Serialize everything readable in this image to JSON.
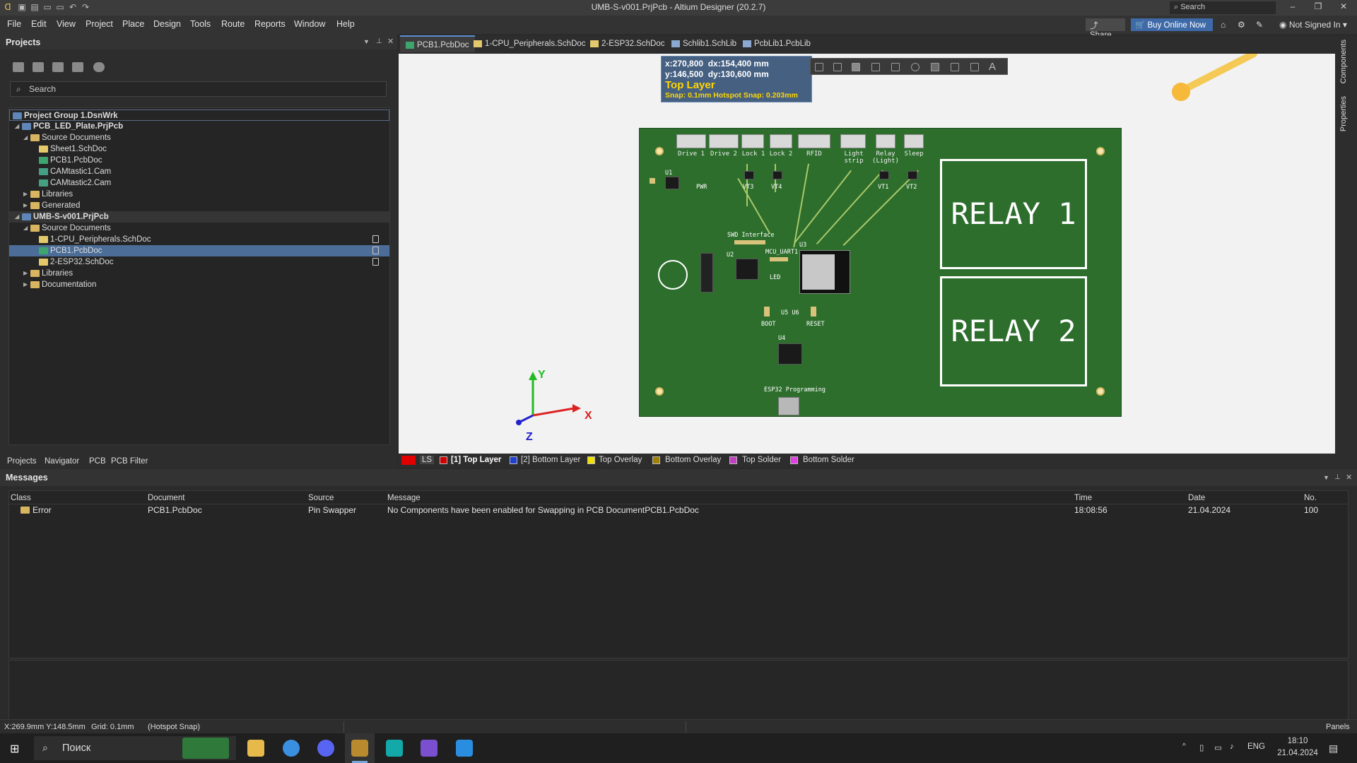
{
  "window": {
    "title": "UMB-S-v001.PrjPcb - Altium Designer (20.2.7)",
    "search_placeholder": "Search",
    "min": "–",
    "max": "❐",
    "close": "✕"
  },
  "menu": [
    "File",
    "Edit",
    "View",
    "Project",
    "Place",
    "Design",
    "Tools",
    "Route",
    "Reports",
    "Window",
    "Help"
  ],
  "topright": {
    "share": "Share",
    "buy": "Buy Online Now",
    "signin": "Not Signed In"
  },
  "projects_panel": {
    "title": "Projects",
    "search_placeholder": "Search",
    "tree": [
      {
        "label": "Project Group 1.DsnWrk"
      },
      {
        "label": "PCB_LED_Plate.PrjPcb"
      },
      {
        "label": "Source Documents"
      },
      {
        "label": "Sheet1.SchDoc"
      },
      {
        "label": "PCB1.PcbDoc"
      },
      {
        "label": "CAMtastic1.Cam"
      },
      {
        "label": "CAMtastic2.Cam"
      },
      {
        "label": "Libraries"
      },
      {
        "label": "Generated"
      },
      {
        "label": "UMB-S-v001.PrjPcb"
      },
      {
        "label": "Source Documents"
      },
      {
        "label": "1-CPU_Peripherals.SchDoc"
      },
      {
        "label": "PCB1.PcbDoc"
      },
      {
        "label": "2-ESP32.SchDoc"
      },
      {
        "label": "Libraries"
      },
      {
        "label": "Documentation"
      }
    ],
    "tabs": [
      "Projects",
      "Navigator",
      "PCB",
      "PCB Filter"
    ]
  },
  "doc_tabs": [
    "PCB1.PcbDoc",
    "1-CPU_Peripherals.SchDoc",
    "2-ESP32.SchDoc",
    "Schlib1.SchLib",
    "PcbLib1.PcbLib"
  ],
  "right_tabs": [
    "Components",
    "Properties"
  ],
  "hud": {
    "x": "x:270,800",
    "dx": "dx:154,400 mm",
    "y": "y:146,500",
    "dy": "dy:130,600 mm",
    "layer": "Top Layer",
    "snap": "Snap: 0.1mm Hotspot Snap: 0.203mm"
  },
  "board": {
    "connectors": [
      "Drive 1",
      "Drive 2",
      "Lock 1",
      "Lock 2",
      "RFID",
      "Light strip",
      "Relay (Light)",
      "Sleep"
    ],
    "relays": [
      "RELAY 1",
      "RELAY 2"
    ],
    "labels": {
      "u1": "U1",
      "pwr": "PWR",
      "swd": "SWD Interface",
      "mcu_uart": "MCU_UART1",
      "u2": "U2",
      "u3": "U3",
      "u4": "U4",
      "u5u6": "U5 U6",
      "led": "LED",
      "boot": "BOOT",
      "reset": "RESET",
      "esp_prog": "ESP32 Programming",
      "vt3": "VT3",
      "vt4": "VT4",
      "vt1": "VT1",
      "vt2": "VT2"
    }
  },
  "axes": {
    "x": "X",
    "y": "Y",
    "z": "Z"
  },
  "layer_bar": [
    {
      "label": "LS",
      "color": "#e00000"
    },
    {
      "label": "[1] Top Layer",
      "color": "#d00000"
    },
    {
      "label": "[2] Bottom Layer",
      "color": "#2040d0"
    },
    {
      "label": "Top Overlay",
      "color": "#f0e000"
    },
    {
      "label": "Bottom Overlay",
      "color": "#a08000"
    },
    {
      "label": "Top Solder",
      "color": "#c040c0"
    },
    {
      "label": "Bottom Solder",
      "color": "#e040e0"
    }
  ],
  "messages": {
    "title": "Messages",
    "columns": [
      "Class",
      "Document",
      "Source",
      "Message",
      "Time",
      "Date",
      "No."
    ],
    "rows": [
      {
        "class": "Error",
        "document": "PCB1.PcbDoc",
        "source": "Pin Swapper",
        "message": "No Components have been enabled for Swapping in PCB DocumentPCB1.PcbDoc",
        "time": "18:08:56",
        "date": "21.04.2024",
        "no": "100"
      }
    ]
  },
  "status": {
    "coords": "X:269.9mm Y:148.5mm",
    "grid": "Grid: 0.1mm",
    "snap": "(Hotspot Snap)",
    "panels": "Panels"
  },
  "taskbar": {
    "search": "Поиск",
    "lang": "ENG",
    "time": "18:10",
    "date": "21.04.2024"
  }
}
